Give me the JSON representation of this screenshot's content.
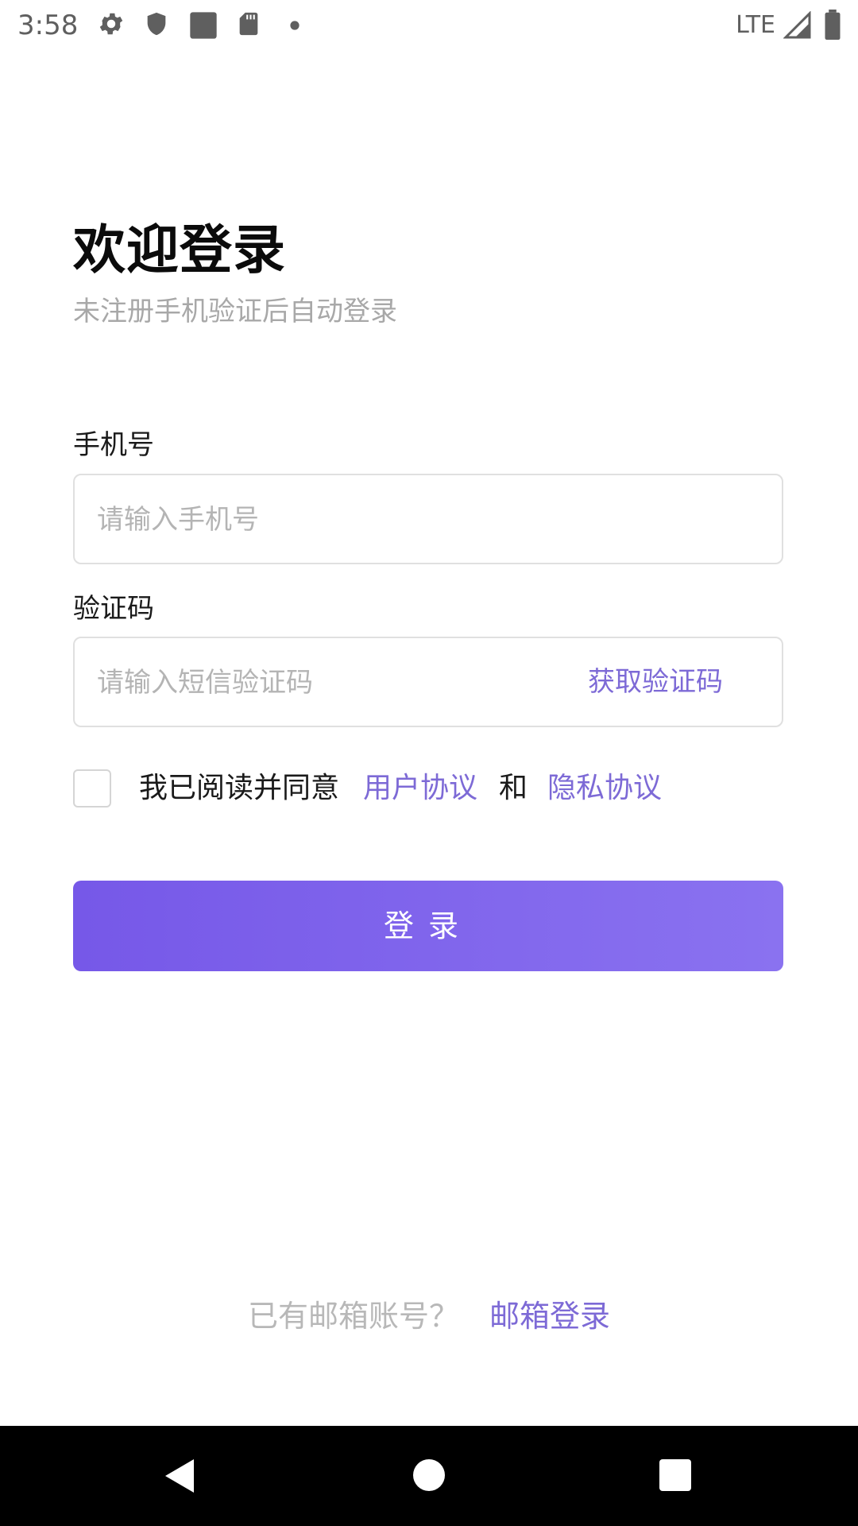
{
  "status_bar": {
    "time": "3:58",
    "network": "LTE",
    "icons": [
      "gear-icon",
      "shield-icon",
      "square-icon",
      "sd-card-icon",
      "dot-icon",
      "signal-icon",
      "battery-icon"
    ]
  },
  "header": {
    "title": "欢迎登录",
    "subtitle": "未注册手机验证后自动登录"
  },
  "form": {
    "phone_label": "手机号",
    "phone_placeholder": "请输入手机号",
    "phone_value": "",
    "code_label": "验证码",
    "code_placeholder": "请输入短信验证码",
    "code_value": "",
    "get_code_label": "获取验证码"
  },
  "agreement": {
    "checked": false,
    "prefix": "我已阅读并同意",
    "user_agreement": "用户协议",
    "and": "和",
    "privacy_agreement": "隐私协议"
  },
  "login_button": "登录",
  "footer": {
    "question": "已有邮箱账号？",
    "email_login": "邮箱登录"
  },
  "nav_bar": {
    "icons": [
      "back-icon",
      "home-icon",
      "recents-icon"
    ]
  },
  "colors": {
    "accent": "#7d6ad6",
    "button_start": "#7658e8",
    "button_end": "#8a72f0"
  }
}
